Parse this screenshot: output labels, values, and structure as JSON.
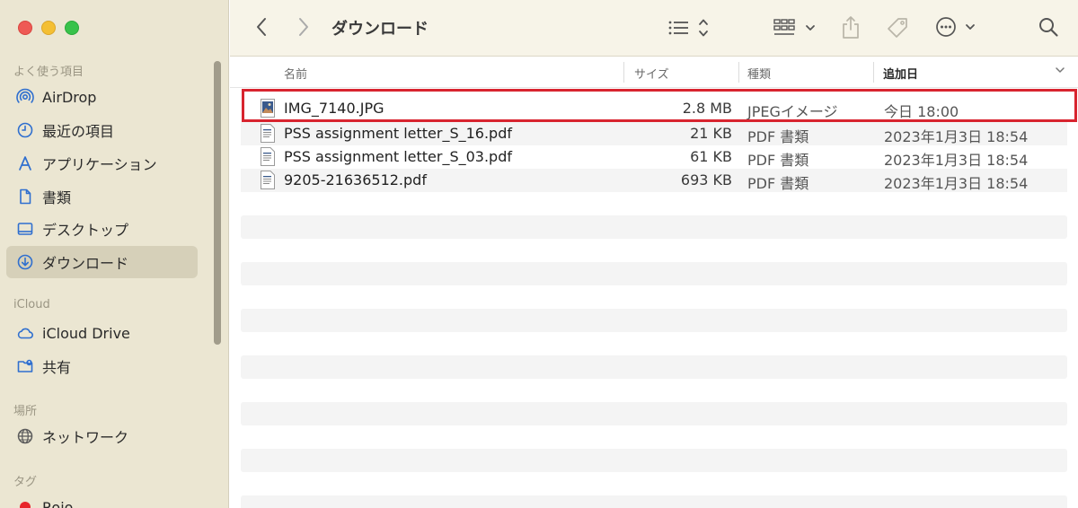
{
  "window": {
    "title": "ダウンロード"
  },
  "sidebar": {
    "sections": [
      {
        "label": "よく使う項目",
        "items": [
          {
            "label": "AirDrop",
            "icon": "airdrop-icon"
          },
          {
            "label": "最近の項目",
            "icon": "clock-icon"
          },
          {
            "label": "アプリケーション",
            "icon": "applications-icon"
          },
          {
            "label": "書類",
            "icon": "document-icon"
          },
          {
            "label": "デスクトップ",
            "icon": "desktop-icon"
          },
          {
            "label": "ダウンロード",
            "icon": "download-icon",
            "selected": true
          }
        ]
      },
      {
        "label": "iCloud",
        "items": [
          {
            "label": "iCloud Drive",
            "icon": "cloud-icon"
          },
          {
            "label": "共有",
            "icon": "shared-folder-icon"
          }
        ]
      },
      {
        "label": "場所",
        "items": [
          {
            "label": "ネットワーク",
            "icon": "globe-icon"
          }
        ]
      },
      {
        "label": "タグ",
        "items": [
          {
            "label": "Rojo",
            "icon": "tag-dot-icon",
            "color": "#e8252b"
          }
        ]
      }
    ]
  },
  "columns": {
    "name": "名前",
    "size": "サイズ",
    "kind": "種類",
    "date_added": "追加日"
  },
  "files": [
    {
      "name": "IMG_7140.JPG",
      "size": "2.8 MB",
      "kind": "JPEGイメージ",
      "date_added": "今日 18:00",
      "icon": "image-file-icon",
      "highlighted": true
    },
    {
      "name": "PSS assignment letter_S_16.pdf",
      "size": "21 KB",
      "kind": "PDF 書類",
      "date_added": "2023年1月3日 18:54",
      "icon": "pdf-file-icon"
    },
    {
      "name": "PSS assignment letter_S_03.pdf",
      "size": "61 KB",
      "kind": "PDF 書類",
      "date_added": "2023年1月3日 18:54",
      "icon": "pdf-file-icon"
    },
    {
      "name": "9205-21636512.pdf",
      "size": "693 KB",
      "kind": "PDF 書類",
      "date_added": "2023年1月3日 18:54",
      "icon": "pdf-file-icon"
    }
  ],
  "colors": {
    "highlight_border": "#d8242f",
    "sidebar_bg": "#ebe6d2",
    "sidebar_icon": "#2f6fcf",
    "tag_red": "#e8252b"
  }
}
